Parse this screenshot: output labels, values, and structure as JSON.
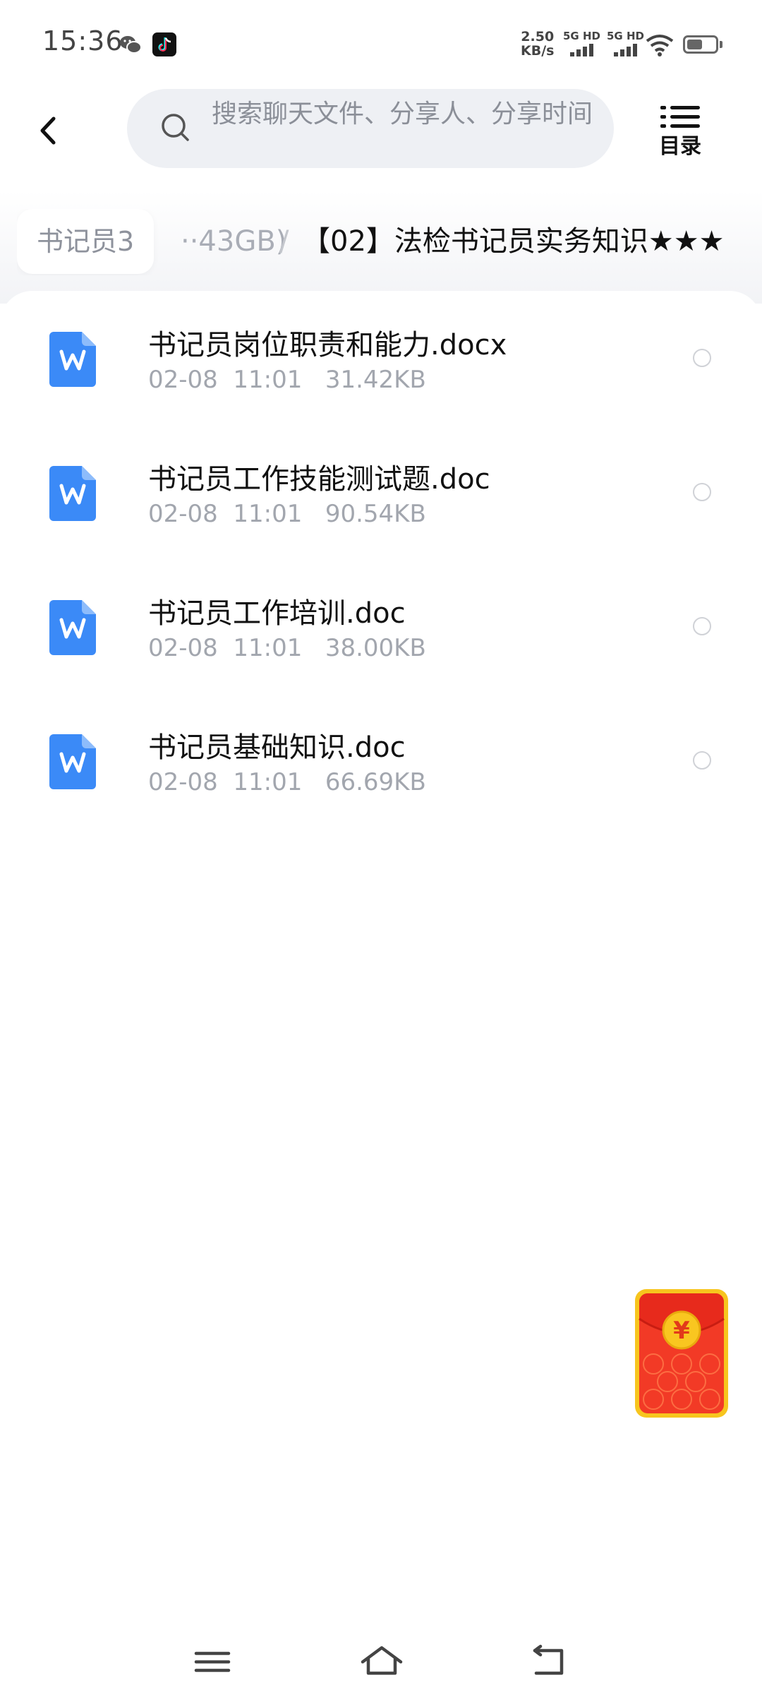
{
  "status_bar": {
    "time": "15:36",
    "net_speed_value": "2.50",
    "net_speed_unit": "KB/s",
    "signal_1_label": "5G HD",
    "signal_2_label": "5G HD",
    "battery_level": 0.55,
    "icons": [
      "wechat-icon",
      "tiktok-icon",
      "signal-icon",
      "wifi-icon",
      "battery-icon"
    ]
  },
  "header": {
    "back_icon": "chevron-left-icon",
    "search": {
      "placeholder": "搜索聊天文件、分享人、分享时间"
    },
    "toc": {
      "label": "目录",
      "icon": "list-icon"
    }
  },
  "breadcrumb": {
    "root": "书记员3",
    "middle": "··43GB)",
    "separator": "/",
    "current": "【02】法检书记员实务知识★★★"
  },
  "files": [
    {
      "name": "书记员岗位职责和能力.docx",
      "date": "02-08",
      "time": "11:01",
      "size": "31.42KB",
      "icon": "word-doc-icon"
    },
    {
      "name": "书记员工作技能测试题.doc",
      "date": "02-08",
      "time": "11:01",
      "size": "90.54KB",
      "icon": "word-doc-icon"
    },
    {
      "name": "书记员工作培训.doc",
      "date": "02-08",
      "time": "11:01",
      "size": "38.00KB",
      "icon": "word-doc-icon"
    },
    {
      "name": "书记员基础知识.doc",
      "date": "02-08",
      "time": "11:01",
      "size": "66.69KB",
      "icon": "word-doc-icon"
    }
  ],
  "floating": {
    "red_packet_symbol": "¥",
    "icon": "red-packet-icon"
  },
  "nav": {
    "icons": [
      "menu-icon",
      "home-icon",
      "back-icon"
    ]
  },
  "colors": {
    "accent_blue": "#3b8af7",
    "red_packet": "#f23a26",
    "gold": "#f7c51e",
    "muted_text": "#a2a6ae"
  }
}
